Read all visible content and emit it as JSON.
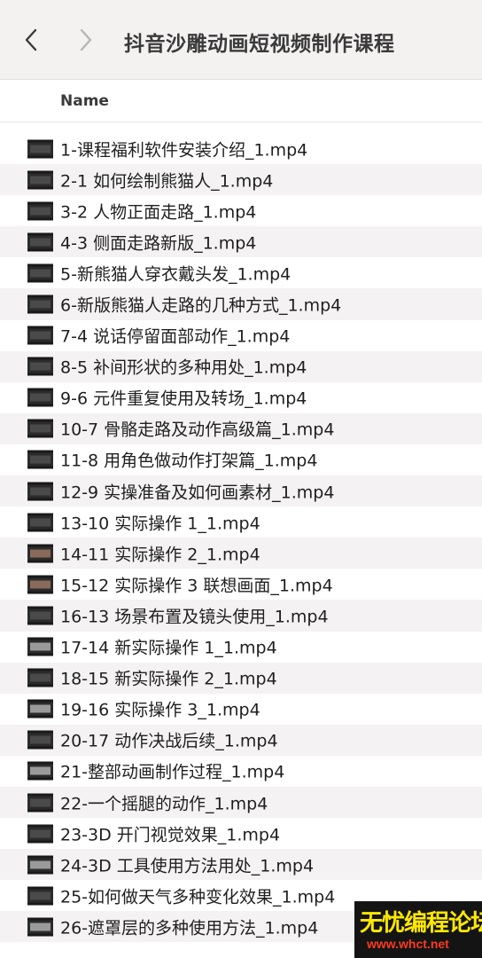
{
  "window": {
    "title": "抖音沙雕动画短视频制作课程"
  },
  "list_header": {
    "name_label": "Name"
  },
  "files": [
    {
      "name": "1-课程福利软件安装介绍_1.mp4"
    },
    {
      "name": "2-1 如何绘制熊猫人_1.mp4"
    },
    {
      "name": "3-2 人物正面走路_1.mp4"
    },
    {
      "name": "4-3 侧面走路新版_1.mp4"
    },
    {
      "name": "5-新熊猫人穿衣戴头发_1.mp4"
    },
    {
      "name": "6-新版熊猫人走路的几种方式_1.mp4"
    },
    {
      "name": "7-4 说话停留面部动作_1.mp4"
    },
    {
      "name": "8-5 补间形状的多种用处_1.mp4"
    },
    {
      "name": "9-6 元件重复使用及转场_1.mp4"
    },
    {
      "name": "10-7 骨骼走路及动作高级篇_1.mp4"
    },
    {
      "name": "11-8 用角色做动作打架篇_1.mp4"
    },
    {
      "name": "12-9 实操准备及如何画素材_1.mp4"
    },
    {
      "name": "13-10 实际操作 1_1.mp4"
    },
    {
      "name": "14-11 实际操作 2_1.mp4"
    },
    {
      "name": "15-12 实际操作 3 联想画面_1.mp4"
    },
    {
      "name": "16-13 场景布置及镜头使用_1.mp4"
    },
    {
      "name": "17-14 新实际操作 1_1.mp4"
    },
    {
      "name": "18-15 新实际操作 2_1.mp4"
    },
    {
      "name": "19-16 实际操作 3_1.mp4"
    },
    {
      "name": "20-17 动作决战后续_1.mp4"
    },
    {
      "name": "21-整部动画制作过程_1.mp4"
    },
    {
      "name": "22-一个摇腿的动作_1.mp4"
    },
    {
      "name": "23-3D 开门视觉效果_1.mp4"
    },
    {
      "name": "24-3D 工具使用方法用处_1.mp4"
    },
    {
      "name": "25-如何做天气多种变化效果_1.mp4"
    },
    {
      "name": "26-遮罩层的多种使用方法_1.mp4"
    }
  ],
  "watermark": {
    "text": "无忧编程论坛",
    "url": "www.whct.net"
  }
}
